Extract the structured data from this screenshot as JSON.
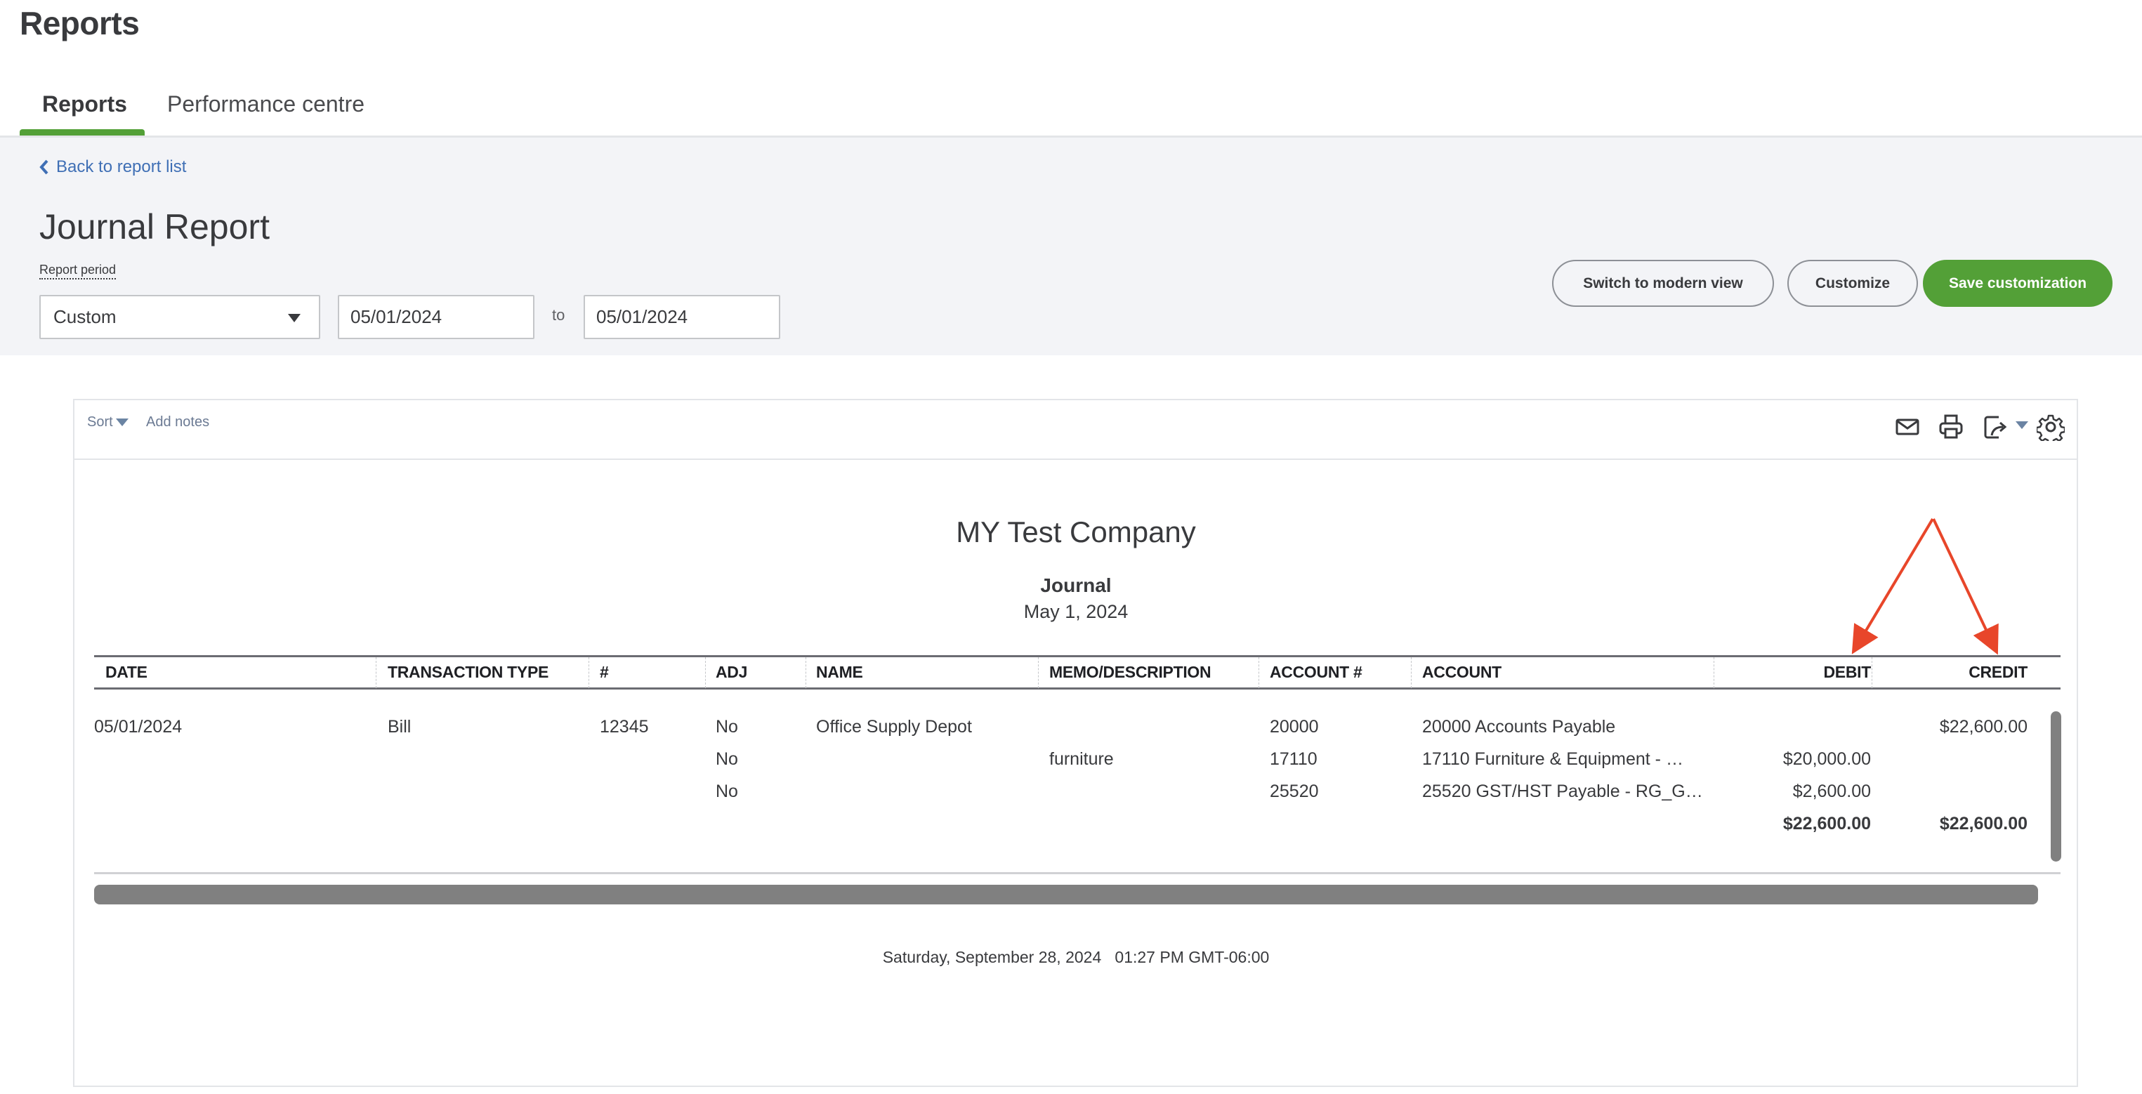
{
  "app": {
    "title": "Reports"
  },
  "tabs": [
    {
      "label": "Reports",
      "active": true
    },
    {
      "label": "Performance centre",
      "active": false
    }
  ],
  "colors": {
    "accent_green": "#53a037",
    "link_blue": "#3f6fb5",
    "band_bg": "#f3f4f7",
    "annotation_red": "#e8462a"
  },
  "header": {
    "back_link": "Back to report list",
    "page_title": "Journal Report",
    "report_period_label": "Report period",
    "period_select": "Custom",
    "date_from": "05/01/2024",
    "to_label": "to",
    "date_to": "05/01/2024",
    "buttons": {
      "switch_modern": "Switch to modern view",
      "customize": "Customize",
      "save_customization": "Save customization"
    }
  },
  "toolbar": {
    "sort_label": "Sort",
    "add_notes_label": "Add notes",
    "icons": [
      "mail-icon",
      "print-icon",
      "export-icon",
      "gear-icon"
    ]
  },
  "report": {
    "company": "MY Test Company",
    "name": "Journal",
    "date": "May 1, 2024",
    "columns": [
      "DATE",
      "TRANSACTION TYPE",
      "#",
      "ADJ",
      "NAME",
      "MEMO/DESCRIPTION",
      "ACCOUNT #",
      "ACCOUNT",
      "DEBIT",
      "CREDIT"
    ],
    "rows": [
      {
        "date": "05/01/2024",
        "type": "Bill",
        "num": "12345",
        "adj": "No",
        "name": "Office Supply Depot",
        "memo": "",
        "acct_num": "20000",
        "account": "20000 Accounts Payable",
        "debit": "",
        "credit": "$22,600.00"
      },
      {
        "date": "",
        "type": "",
        "num": "",
        "adj": "No",
        "name": "",
        "memo": "furniture",
        "acct_num": "17110",
        "account": "17110 Furniture & Equipment - …",
        "debit": "$20,000.00",
        "credit": ""
      },
      {
        "date": "",
        "type": "",
        "num": "",
        "adj": "No",
        "name": "",
        "memo": "",
        "acct_num": "25520",
        "account": "25520 GST/HST Payable - RG_G…",
        "debit": "$2,600.00",
        "credit": ""
      }
    ],
    "totals": {
      "debit": "$22,600.00",
      "credit": "$22,600.00"
    },
    "footer_timestamp": "Saturday, September 28, 2024   01:27 PM GMT-06:00"
  },
  "annotation": {
    "description": "Red arrows pointing to DEBIT and CREDIT column headers"
  }
}
